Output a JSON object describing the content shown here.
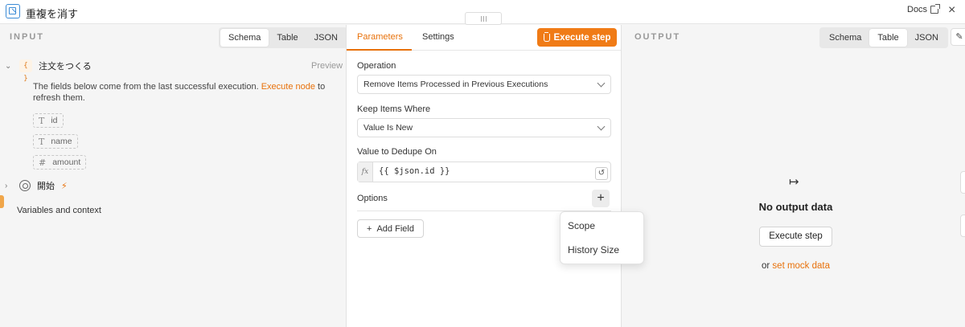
{
  "header": {
    "title": "重複を消す",
    "docs_label": "Docs",
    "close_glyph": "×"
  },
  "input": {
    "label": "INPUT",
    "tabs": [
      "Schema",
      "Table",
      "JSON"
    ],
    "active_tab": "Schema",
    "node_name": "注文をつくる",
    "preview_label": "Preview",
    "note_text": "The fields below come from the last successful execution.",
    "note_link": "Execute node",
    "note_tail": "to refresh them.",
    "fields": [
      {
        "type_icon": "T",
        "name": "id"
      },
      {
        "type_icon": "T",
        "name": "name"
      },
      {
        "type_icon": "#",
        "name": "amount"
      }
    ],
    "trigger_name": "開始",
    "variables_label": "Variables and context"
  },
  "params": {
    "tabs": [
      "Parameters",
      "Settings"
    ],
    "active_tab": "Parameters",
    "execute_label": "Execute step",
    "operation_label": "Operation",
    "operation_value": "Remove Items Processed in Previous Executions",
    "keep_label": "Keep Items Where",
    "keep_value": "Value Is New",
    "dedupe_label": "Value to Dedupe On",
    "fx_label": "fx",
    "dedupe_value": "{{ $json.id }}",
    "options_label": "Options",
    "add_field_label": "Add Field",
    "options_menu": [
      "Scope",
      "History Size"
    ]
  },
  "output": {
    "label": "OUTPUT",
    "tabs": [
      "Schema",
      "Table",
      "JSON"
    ],
    "active_tab": "Table",
    "empty_title": "No output data",
    "execute_label": "Execute step",
    "mock_prefix": "or",
    "mock_link": "set mock data"
  },
  "colors": {
    "accent": "#e8710a",
    "execute_button": "#f07b16"
  }
}
